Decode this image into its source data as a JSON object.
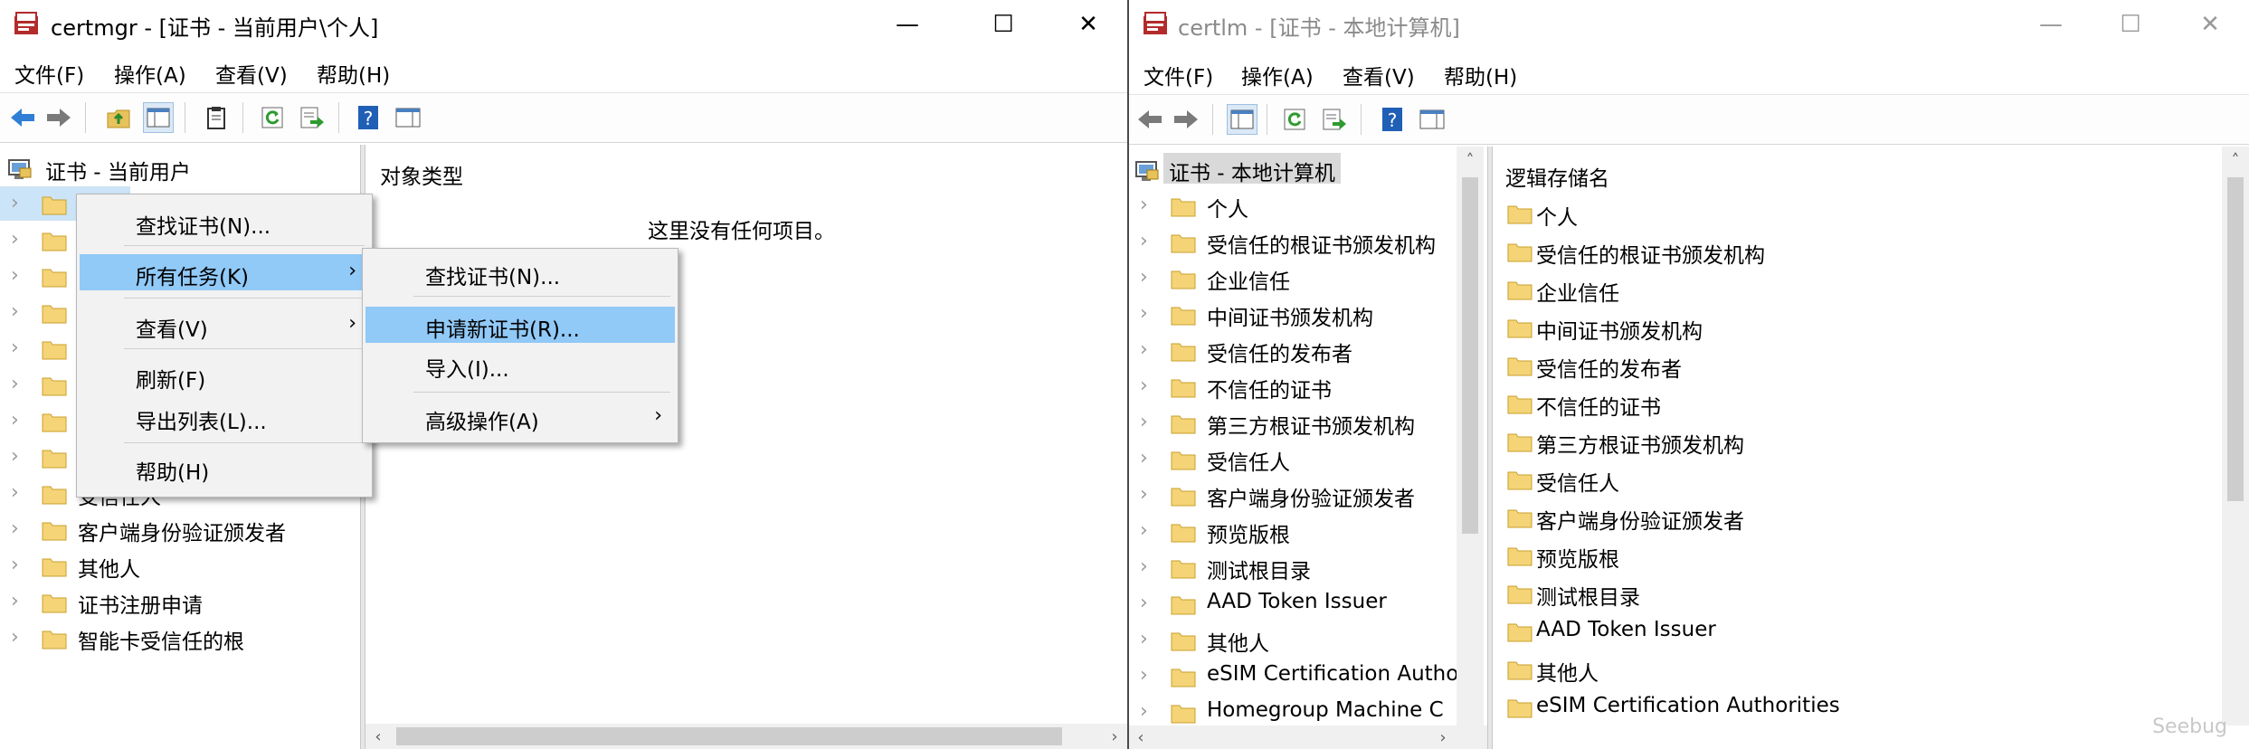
{
  "left_window": {
    "title": "certmgr - [证书 - 当前用户\\个人]",
    "menu": [
      "文件(F)",
      "操作(A)",
      "查看(V)",
      "帮助(H)"
    ],
    "tree_root": "证书 - 当前用户",
    "tree_items": [
      "",
      "",
      "",
      "",
      "",
      "",
      "",
      "",
      "受信任人",
      "客户端身份验证颁发者",
      "其他人",
      "证书注册申请",
      "智能卡受信任的根"
    ],
    "list_header": "对象类型",
    "empty_text": "这里没有任何项目。",
    "context_menu": {
      "items": [
        "查找证书(N)...",
        "所有任务(K)",
        "查看(V)",
        "刷新(F)",
        "导出列表(L)...",
        "帮助(H)"
      ]
    },
    "submenu": {
      "items": [
        "查找证书(N)...",
        "申请新证书(R)...",
        "导入(I)...",
        "高级操作(A)"
      ]
    }
  },
  "right_window": {
    "title": "certlm - [证书 - 本地计算机]",
    "menu": [
      "文件(F)",
      "操作(A)",
      "查看(V)",
      "帮助(H)"
    ],
    "tree_root": "证书 - 本地计算机",
    "tree_items": [
      "个人",
      "受信任的根证书颁发机构",
      "企业信任",
      "中间证书颁发机构",
      "受信任的发布者",
      "不信任的证书",
      "第三方根证书颁发机构",
      "受信任人",
      "客户端身份验证颁发者",
      "预览版根",
      "测试根目录",
      "AAD Token Issuer",
      "其他人",
      "eSIM Certification Autho",
      "Homegroup Machine C"
    ],
    "list_header": "逻辑存储名",
    "list_items": [
      "个人",
      "受信任的根证书颁发机构",
      "企业信任",
      "中间证书颁发机构",
      "受信任的发布者",
      "不信任的证书",
      "第三方根证书颁发机构",
      "受信任人",
      "客户端身份验证颁发者",
      "预览版根",
      "测试根目录",
      "AAD Token Issuer",
      "其他人",
      "eSIM Certification Authorities"
    ]
  },
  "window_controls": {
    "minimize": "—",
    "maximize": "☐",
    "close": "✕"
  },
  "watermark": "Seebug",
  "colors": {
    "selection": "#91c9f7",
    "folder": "#f5d478",
    "accent": "#1e6fc6"
  }
}
